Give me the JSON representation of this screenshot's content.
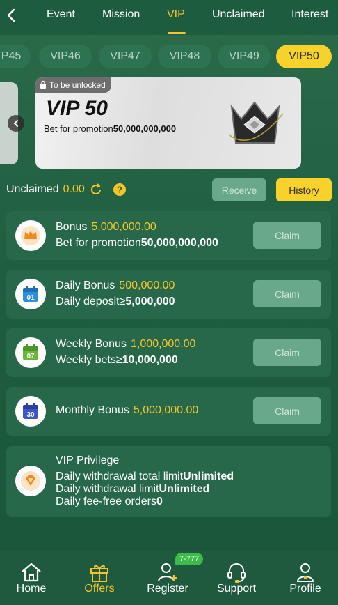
{
  "topnav": {
    "tabs": [
      {
        "label": "Event",
        "active": false
      },
      {
        "label": "Mission",
        "active": false
      },
      {
        "label": "VIP",
        "active": true
      },
      {
        "label": "Unclaimed",
        "active": false
      },
      {
        "label": "Interest",
        "active": false
      }
    ]
  },
  "vip_levels": [
    "P45",
    "VIP46",
    "VIP47",
    "VIP48",
    "VIP49",
    "VIP50"
  ],
  "selected_level": "VIP50",
  "banner": {
    "lock_label": "To be unlocked",
    "title": "VIP 50",
    "subtitle_prefix": "Bet for promotion",
    "subtitle_value": "50,000,000,000"
  },
  "unclaimed": {
    "label": "Unclaimed",
    "amount": "0.00",
    "receive_label": "Receive",
    "history_label": "History"
  },
  "rewards": [
    {
      "title": "Bonus",
      "value": "5,000,000.00",
      "sub_prefix": "Bet for promotion",
      "sub_value": "50,000,000,000",
      "icon": "crown-icon",
      "button": "Claim"
    },
    {
      "title": "Daily Bonus",
      "value": "500,000.00",
      "sub_prefix": "Daily deposit≥",
      "sub_value": "5,000,000",
      "icon": "calendar-01-icon",
      "icon_text": "01",
      "button": "Claim"
    },
    {
      "title": "Weekly Bonus",
      "value": "1,000,000.00",
      "sub_prefix": "Weekly bets≥",
      "sub_value": "10,000,000",
      "icon": "calendar-07-icon",
      "icon_text": "07",
      "button": "Claim"
    },
    {
      "title": "Monthly Bonus",
      "value": "5,000,000.00",
      "icon": "calendar-30-icon",
      "icon_text": "30",
      "button": "Claim"
    }
  ],
  "privilege": {
    "title": "VIP Privilege",
    "lines": [
      {
        "prefix": "Daily withdrawal total limit",
        "value": "Unlimited"
      },
      {
        "prefix": "Daily withdrawal limit",
        "value": "Unlimited"
      },
      {
        "prefix": "Daily fee-free orders",
        "value": "0"
      }
    ]
  },
  "bottomnav": {
    "items": [
      {
        "label": "Home",
        "icon": "home-icon",
        "active": false
      },
      {
        "label": "Offers",
        "icon": "gift-icon",
        "active": true
      },
      {
        "label": "Register",
        "icon": "add-user-icon",
        "active": false
      },
      {
        "label": "Support",
        "icon": "headset-icon",
        "active": false
      },
      {
        "label": "Profile",
        "icon": "user-icon",
        "active": false
      }
    ],
    "register_badge": "7-777"
  },
  "colors": {
    "accent": "#f7c52b",
    "background": "#1f5e40",
    "card": "#27684a",
    "button_disabled": "#6aa88a"
  }
}
